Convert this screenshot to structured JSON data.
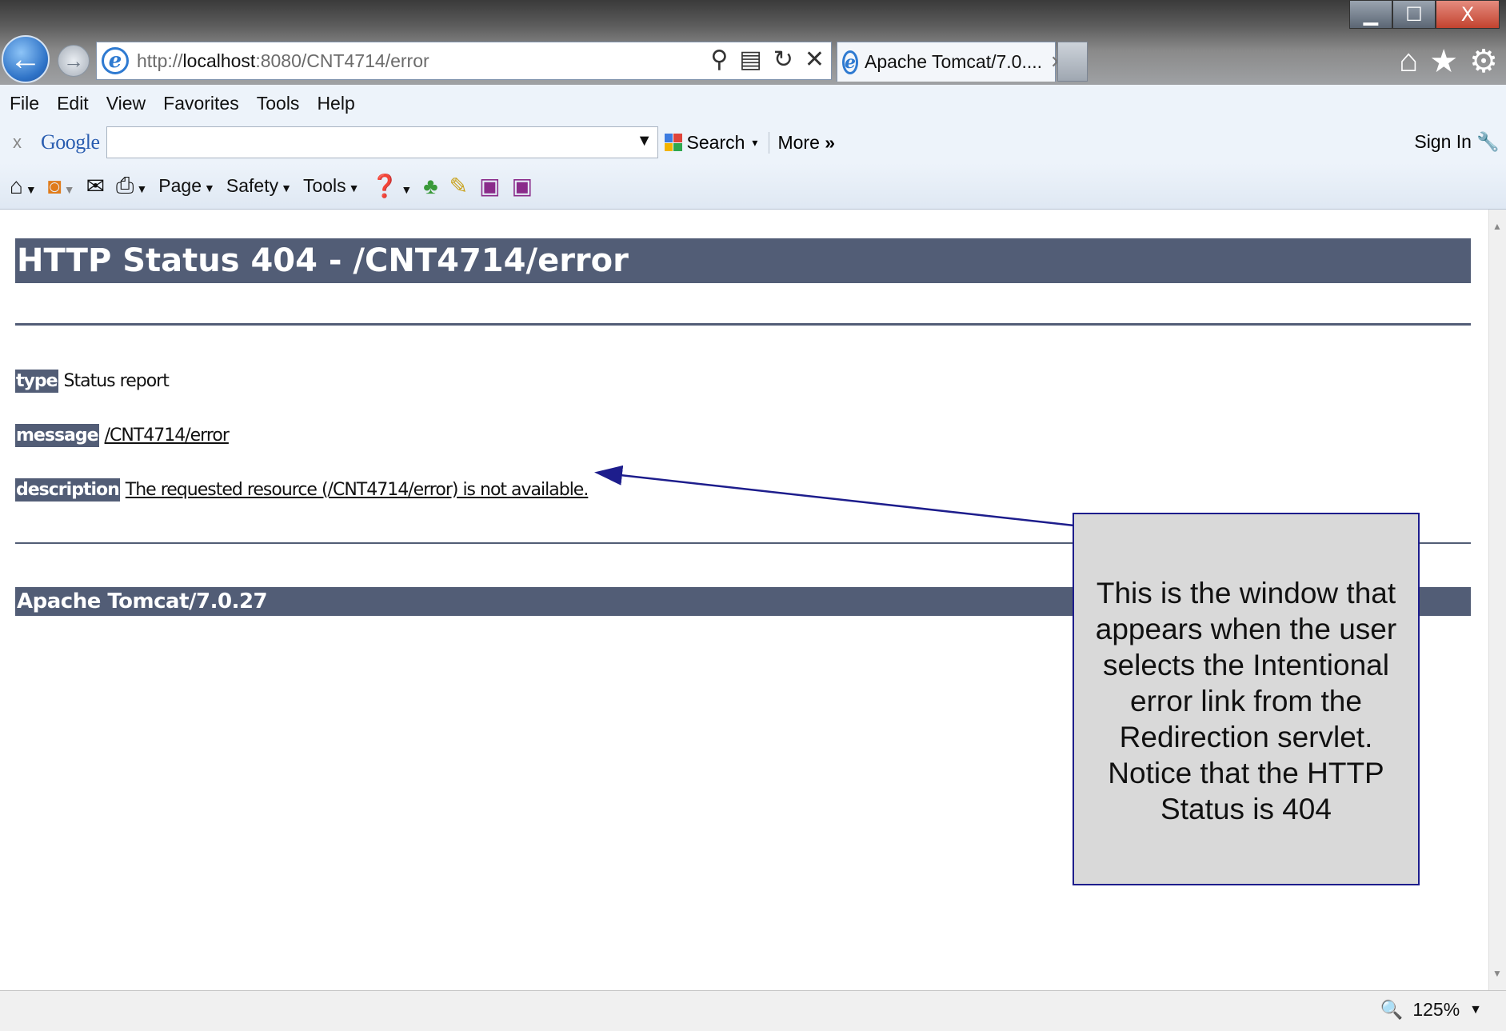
{
  "browser": {
    "address_url_prefix": "http://",
    "address_url_host": "localhost",
    "address_url_rest": ":8080/CNT4714/error",
    "tab_title": "Apache Tomcat/7.0....",
    "window_controls": {
      "minimize": "▁",
      "maximize": "☐",
      "close": "X"
    }
  },
  "menu": [
    "File",
    "Edit",
    "View",
    "Favorites",
    "Tools",
    "Help"
  ],
  "google_toolbar": {
    "close": "x",
    "logo": "Google",
    "search_value": "",
    "search_label": "Search",
    "more_label": "More",
    "sign_in": "Sign In"
  },
  "command_bar": {
    "page": "Page",
    "safety": "Safety",
    "tools": "Tools"
  },
  "page": {
    "title": "HTTP Status 404 - /CNT4714/error",
    "type_label": "type",
    "type_value": "Status report",
    "message_label": "message",
    "message_value": "/CNT4714/error",
    "description_label": "description",
    "description_value": "The requested resource (/CNT4714/error) is not available.",
    "footer": "Apache Tomcat/7.0.27"
  },
  "callout": {
    "text": "This is the window that appears when the user selects the Intentional error link from the Redirection servlet. Notice that the HTTP Status is 404"
  },
  "status_bar": {
    "zoom": "125%"
  },
  "colors": {
    "tomcat_header": "#525d76",
    "callout_bg": "#d9d9d9",
    "callout_border": "#1d1d8c",
    "arrow": "#1d1d8c"
  }
}
